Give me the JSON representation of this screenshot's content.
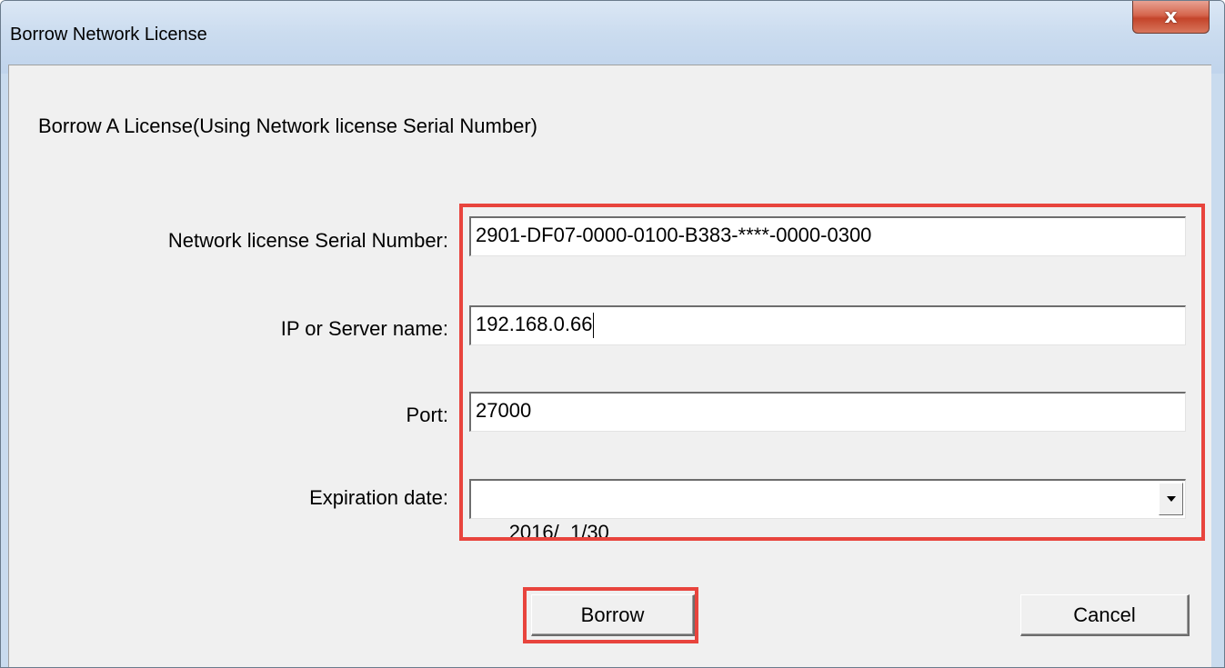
{
  "window": {
    "title": "Borrow Network License",
    "close_glyph": "x"
  },
  "dialog": {
    "heading": "Borrow A License(Using Network license Serial Number)",
    "fields": {
      "serial_number": {
        "label": "Network license Serial Number:",
        "value": "2901-DF07-0000-0100-B383-****-0000-0300"
      },
      "server": {
        "label": "IP or Server name:",
        "value": "192.168.0.66"
      },
      "port": {
        "label": "Port:",
        "value": "27000"
      },
      "expiration": {
        "label": "Expiration date:",
        "value": "2016/  1/30"
      }
    },
    "buttons": {
      "borrow": "Borrow",
      "cancel": "Cancel"
    }
  },
  "colors": {
    "highlight": "#e8443d",
    "client_background": "#f0f0f0",
    "titlebar": "#cbdcef"
  },
  "icons": {
    "close": "close-icon",
    "dropdown": "chevron-down-icon"
  }
}
